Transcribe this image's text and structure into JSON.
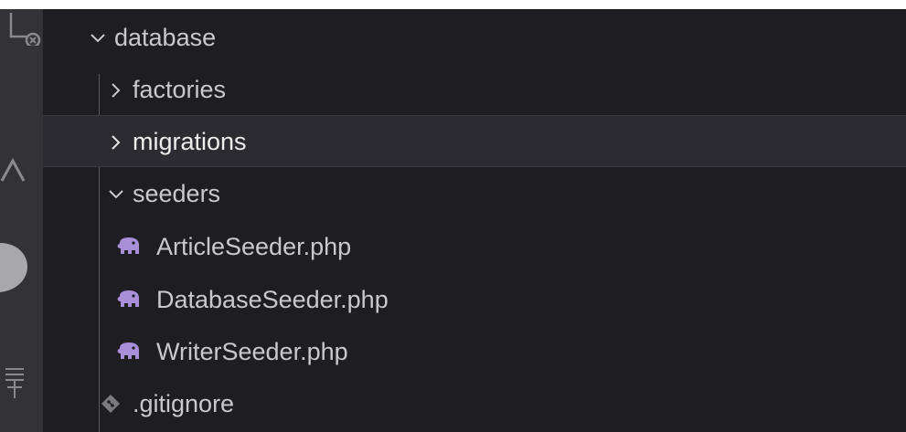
{
  "explorer": {
    "tree": [
      {
        "label": "database",
        "kind": "folder",
        "expanded": true
      },
      {
        "label": "factories",
        "kind": "folder",
        "expanded": false
      },
      {
        "label": "migrations",
        "kind": "folder",
        "expanded": false,
        "hovered": true
      },
      {
        "label": "seeders",
        "kind": "folder",
        "expanded": true
      },
      {
        "label": "ArticleSeeder.php",
        "kind": "file",
        "icon": "php-elephant-icon"
      },
      {
        "label": "DatabaseSeeder.php",
        "kind": "file",
        "icon": "php-elephant-icon"
      },
      {
        "label": "WriterSeeder.php",
        "kind": "file",
        "icon": "php-elephant-icon"
      },
      {
        "label": ".gitignore",
        "kind": "file",
        "icon": "git-icon"
      }
    ]
  },
  "colors": {
    "activity_bar": "#333337",
    "sidebar_background": "#1e1e22",
    "hover_row": "#2b2b31",
    "text": "#c9c9cd",
    "php_icon": "#a98ed8",
    "git_icon": "#7a7a80"
  }
}
